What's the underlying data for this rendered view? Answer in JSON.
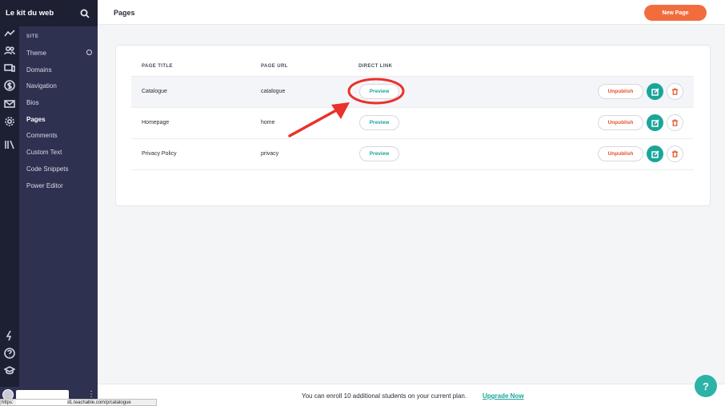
{
  "app": {
    "brand": "Le kit du web"
  },
  "sidebar": {
    "section_label": "SITE",
    "items": [
      {
        "label": "Theme"
      },
      {
        "label": "Domains"
      },
      {
        "label": "Navigation"
      },
      {
        "label": "Bios"
      },
      {
        "label": "Pages"
      },
      {
        "label": "Comments"
      },
      {
        "label": "Custom Text"
      },
      {
        "label": "Code Snippets"
      },
      {
        "label": "Power Editor"
      }
    ],
    "active": "Pages"
  },
  "rail_icons": [
    "trend-icon",
    "users-icon",
    "devices-icon",
    "dollar-icon",
    "mail-icon",
    "gear-icon",
    "library-icon",
    "bolt-icon",
    "help-circle-icon",
    "graduation-cap-icon"
  ],
  "header": {
    "title": "Pages",
    "new_page_label": "New Page"
  },
  "table": {
    "headers": [
      "PAGE TITLE",
      "PAGE URL",
      "DIRECT LINK"
    ],
    "rows": [
      {
        "title": "Catalogue",
        "url": "catalogue",
        "preview": "Preview",
        "unpublish": "Unpublish"
      },
      {
        "title": "Homepage",
        "url": "home",
        "preview": "Preview",
        "unpublish": "Unpublish"
      },
      {
        "title": "Privacy Policy",
        "url": "privacy",
        "preview": "Preview",
        "unpublish": "Unpublish"
      }
    ]
  },
  "footer": {
    "message": "You can enroll 10 additional students on your current plan.",
    "upgrade_label": "Upgrade Now"
  },
  "help_label": "?",
  "status_bar": {
    "url_prefix": "https:",
    "url_suffix": "hool1.teachable.com/p/catalogue"
  },
  "colors": {
    "accent": "#1aa59a",
    "orange": "#f26d3d",
    "danger": "#e2532c",
    "sidebar": "#2e3150",
    "annotation": "#e8322b"
  }
}
